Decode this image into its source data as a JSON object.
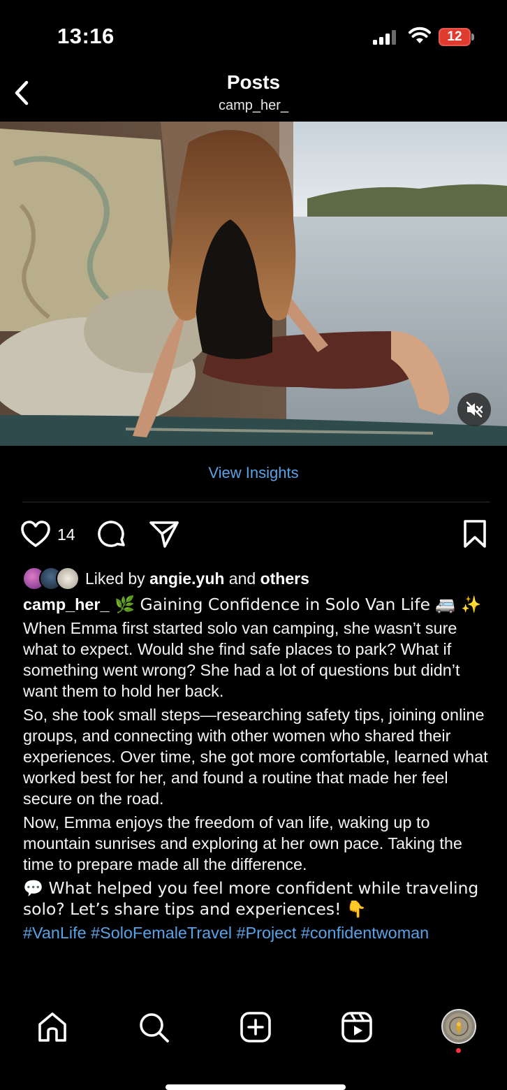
{
  "status_bar": {
    "time": "13:16",
    "battery_level": "12",
    "battery_color": "#e03b2f"
  },
  "header": {
    "title": "Posts",
    "subtitle": "camp_her_",
    "back_icon": "chevron-left-icon"
  },
  "media": {
    "mute_icon": "speaker-muted-icon"
  },
  "insights": {
    "label": "View Insights",
    "color": "#5aa2e6"
  },
  "actions": {
    "like_icon": "heart-icon",
    "like_count": "14",
    "comment_icon": "comment-bubble-icon",
    "share_icon": "paper-plane-icon",
    "save_icon": "bookmark-icon"
  },
  "liked_by": {
    "prefix": "Liked by ",
    "user": "angie.yuh",
    "middle": " and ",
    "others": "others"
  },
  "caption": {
    "username": "camp_her_",
    "title_line": " 🌿 Gaining Confidence in Solo Van Life 🚐 ✨",
    "paragraph_1": "When Emma first started solo van camping, she wasn’t sure what to expect. Would she find safe places to park? What if something went wrong? She had a lot of questions but didn’t want them to hold her back.",
    "paragraph_2": "So, she took small steps—researching safety tips, joining online groups, and connecting with other women who shared their experiences. Over time, she got more comfortable, learned what worked best for her, and found a routine that made her feel secure on the road.",
    "paragraph_3": "Now, Emma enjoys the freedom of van life, waking up to mountain sunrises and exploring at her own pace. Taking the time to prepare made all the difference.",
    "paragraph_4": "💬 What helped you feel more confident while traveling solo? Let’s share tips and experiences! 👇",
    "hashtags": "#VanLife #SoloFemaleTravel #Project #confidentwoman"
  },
  "bottom_nav": {
    "items": [
      "home-icon",
      "search-icon",
      "create-post-icon",
      "reels-icon",
      "profile-avatar"
    ]
  }
}
